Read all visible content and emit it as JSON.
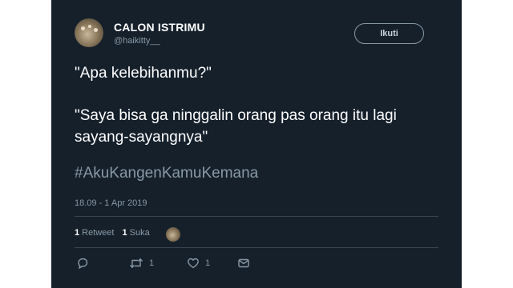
{
  "user": {
    "name": "CALON ISTRIMU",
    "handle": "@haikitty__"
  },
  "follow_label": "Ikuti",
  "tweet": {
    "line1": "\"Apa kelebihanmu?\"",
    "line2": "\"Saya bisa ga ninggalin orang pas orang itu lagi sayang-sayangnya\"",
    "hashtag": "#AkuKangenKamuKemana",
    "timestamp": "18.09 - 1 Apr 2019"
  },
  "stats": {
    "retweet_count": "1",
    "retweet_label": "Retweet",
    "like_count": "1",
    "like_label": "Suka"
  },
  "actions": {
    "reply_icon": "reply-icon",
    "retweet_icon": "retweet-icon",
    "retweet_count": "1",
    "like_icon": "heart-icon",
    "like_count": "1",
    "message_icon": "envelope-icon"
  },
  "colors": {
    "background": "#15202b",
    "secondary_text": "#8899a6",
    "divider": "#38444d"
  }
}
